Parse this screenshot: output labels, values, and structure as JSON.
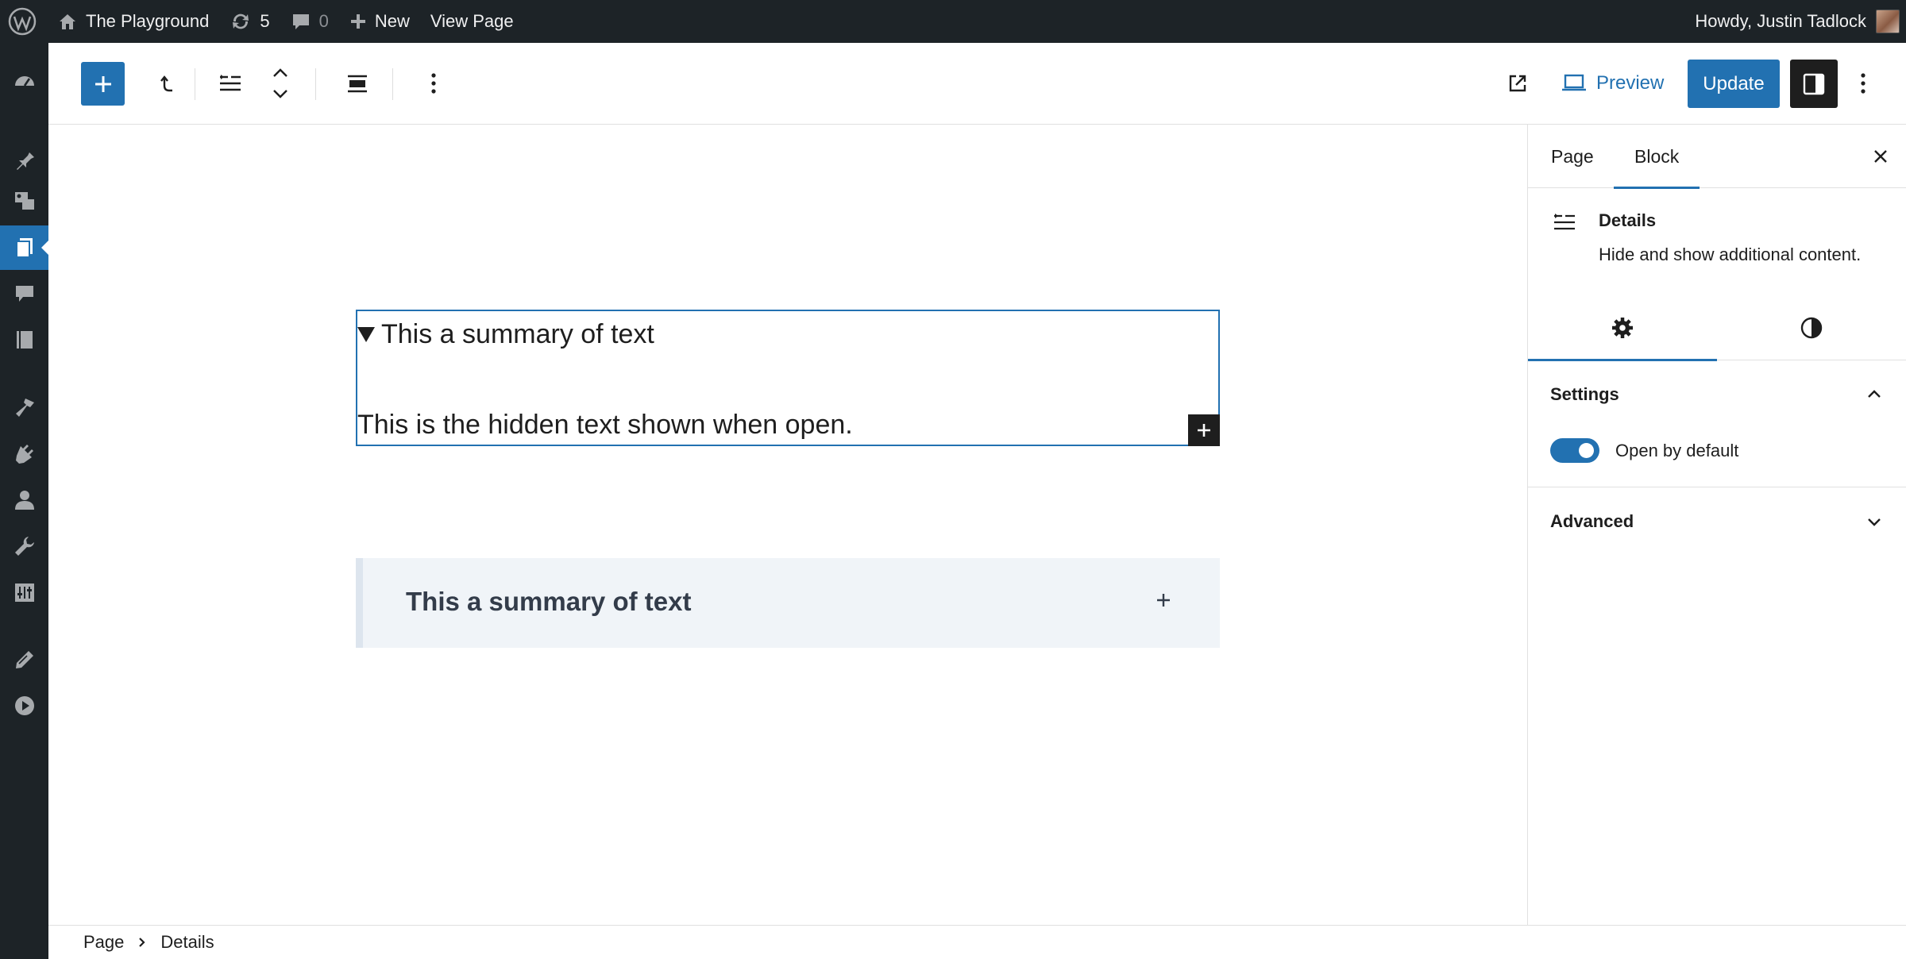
{
  "admin_bar": {
    "site_name": "The Playground",
    "updates_count": "5",
    "comments_count": "0",
    "new_label": "New",
    "view_page_label": "View Page",
    "greeting": "Howdy, Justin Tadlock"
  },
  "admin_menu": {
    "icons": [
      "dashboard-icon",
      "posts-icon",
      "media-icon",
      "pages-icon",
      "comments-icon",
      "library-icon",
      "appearance-icon",
      "plugins-icon",
      "users-icon",
      "tools-icon",
      "settings-icon",
      "edit-icon",
      "play-icon"
    ],
    "active": "pages-icon"
  },
  "toolbar": {
    "preview_label": "Preview",
    "update_label": "Update"
  },
  "canvas": {
    "details_summary": "This a summary of text",
    "details_hidden_text": "This is the hidden text shown when open.",
    "collapsed_summary": "This a summary of text"
  },
  "sidebar": {
    "tabs": [
      {
        "label": "Page",
        "active": false
      },
      {
        "label": "Block",
        "active": true
      }
    ],
    "block_card": {
      "title": "Details",
      "description": "Hide and show additional content."
    },
    "settings_panel": {
      "title": "Settings",
      "toggle_label": "Open by default",
      "toggle_on": true
    },
    "advanced_panel": {
      "title": "Advanced"
    }
  },
  "breadcrumb": [
    "Page",
    "Details"
  ],
  "colors": {
    "accent": "#2271b1",
    "admin_bg": "#1d2327",
    "dark_button": "#1e1e1e"
  }
}
